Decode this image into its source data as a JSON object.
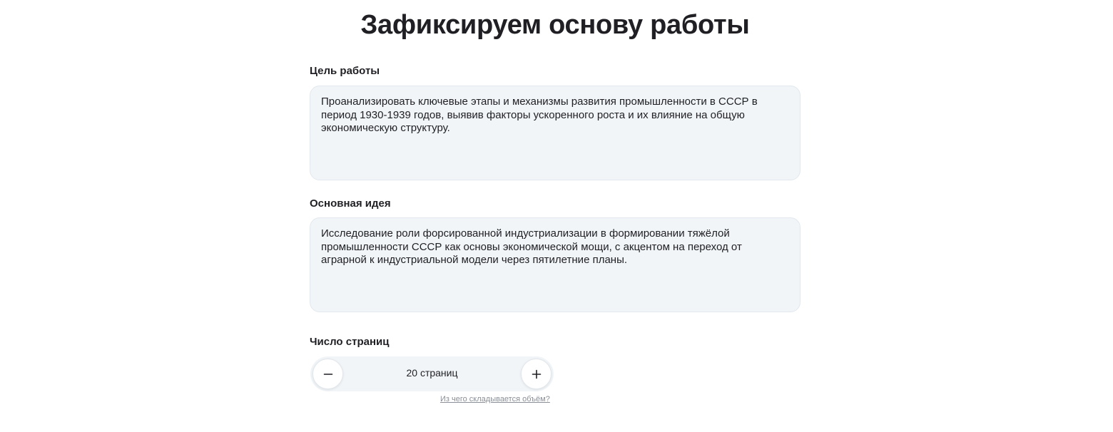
{
  "page": {
    "title": "Зафиксируем основу работы"
  },
  "form": {
    "goal": {
      "label": "Цель работы",
      "value": "Проанализировать ключевые этапы и механизмы развития промышленности в СССР в период 1930-1939 годов, выявив факторы ускоренного роста и их влияние на общую экономическую структуру."
    },
    "idea": {
      "label": "Основная идея",
      "value": "Исследование роли форсированной индустриализации в формировании тяжёлой промышленности СССР как основы экономической мощи, с акцентом на переход от аграрной к индустриальной модели через пятилетние планы."
    },
    "pages": {
      "label": "Число страниц",
      "value_text": "20 страниц",
      "value": 20,
      "decrement_icon": "minus-icon",
      "increment_icon": "plus-icon",
      "help_link": "Из чего складывается объём?"
    }
  },
  "colors": {
    "text": "#1f1f24",
    "field_background": "#f1f5f8",
    "link": "#8a8f97"
  }
}
